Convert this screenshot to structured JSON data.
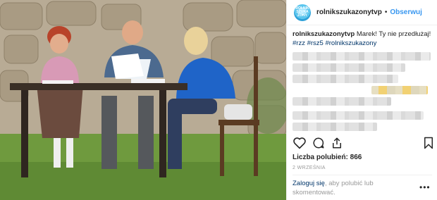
{
  "post": {
    "photo_description_icon": "tv-show-photo",
    "header": {
      "avatar_text": "ROLNIK SZUKA ŻONY",
      "username": "rolnikszukazonytvp",
      "separator": "•",
      "follow_label": "Obserwuj"
    },
    "caption": {
      "username": "rolnikszukazonytvp",
      "text": "Marek! Ty nie przedłużaj!",
      "hashtags": [
        "#rzz",
        "#rsz5",
        "#rolnikszukazony"
      ]
    },
    "actions": {
      "like_icon": "heart-icon",
      "comment_icon": "comment-icon",
      "share_icon": "share-icon",
      "save_icon": "bookmark-icon"
    },
    "likes_label": "Liczba polubień: 866",
    "date_label": "2 WRZEŚNIA",
    "footer": {
      "login_link": "Zaloguj się",
      "login_suffix": ", aby polubić lub skomentować.",
      "more_icon": "more-icon",
      "more_glyph": "•••"
    },
    "colors": {
      "link_blue": "#3897f0",
      "hashtag_blue": "#003569",
      "muted_gray": "#999999"
    }
  }
}
